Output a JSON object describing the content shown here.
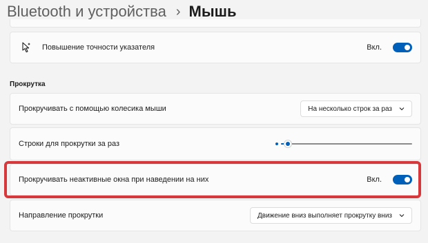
{
  "breadcrumb": {
    "parent": "Bluetooth и устройства",
    "separator": "›",
    "current": "Мышь"
  },
  "pointer_precision": {
    "icon": "pointer-sparkle-icon",
    "label": "Повышение точности указателя",
    "state": "Вкл.",
    "enabled": true
  },
  "scroll_section": {
    "title": "Прокрутка"
  },
  "wheel_scroll": {
    "label": "Прокручивать с помощью колесика мыши",
    "value": "На несколько строк за раз"
  },
  "lines_per_scroll": {
    "label": "Строки для прокрутки за раз",
    "level": 0.05
  },
  "inactive_scroll": {
    "label": "Прокручивать неактивные окна при наведении на них",
    "state": "Вкл.",
    "enabled": true
  },
  "scroll_direction": {
    "label": "Направление прокрутки",
    "value": "Движение вниз выполняет прокрутку вниз"
  },
  "colors": {
    "accent": "#005fb8",
    "highlight": "#d6383b",
    "background": "#f3f3f3",
    "card": "#fbfbfb"
  }
}
